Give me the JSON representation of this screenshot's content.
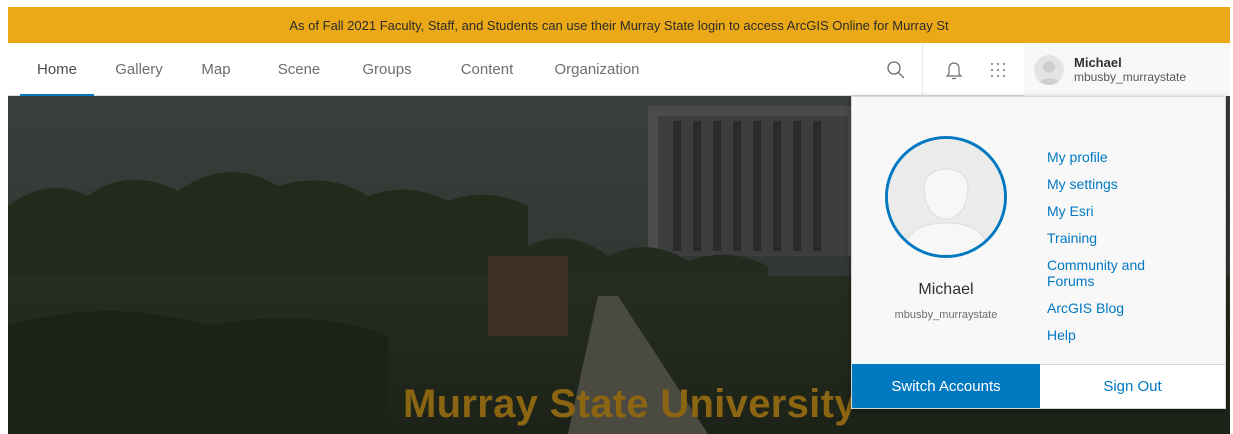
{
  "banner": {
    "text": "As of Fall 2021 Faculty, Staff, and Students can use their Murray State login to access ArcGIS Online for Murray St"
  },
  "nav": {
    "tabs": [
      {
        "label": "Home",
        "active": true
      },
      {
        "label": "Gallery",
        "active": false
      },
      {
        "label": "Map",
        "active": false
      },
      {
        "label": "Scene",
        "active": false
      },
      {
        "label": "Groups",
        "active": false
      },
      {
        "label": "Content",
        "active": false
      },
      {
        "label": "Organization",
        "active": false
      }
    ],
    "icons": [
      "search-icon",
      "bell-icon",
      "app-launcher-icon"
    ]
  },
  "user": {
    "name": "Michael",
    "username": "mbusby_murraystate"
  },
  "hero": {
    "title": "Murray State University"
  },
  "dropdown": {
    "name": "Michael",
    "username": "mbusby_murraystate",
    "links": [
      "My profile",
      "My settings",
      "My Esri",
      "Training",
      "Community and Forums",
      "ArcGIS Blog",
      "Help"
    ],
    "switch_label": "Switch Accounts",
    "signout_label": "Sign Out"
  },
  "colors": {
    "banner": "#eba917",
    "accent": "#0079c1",
    "hero_title": "#8c6512"
  }
}
